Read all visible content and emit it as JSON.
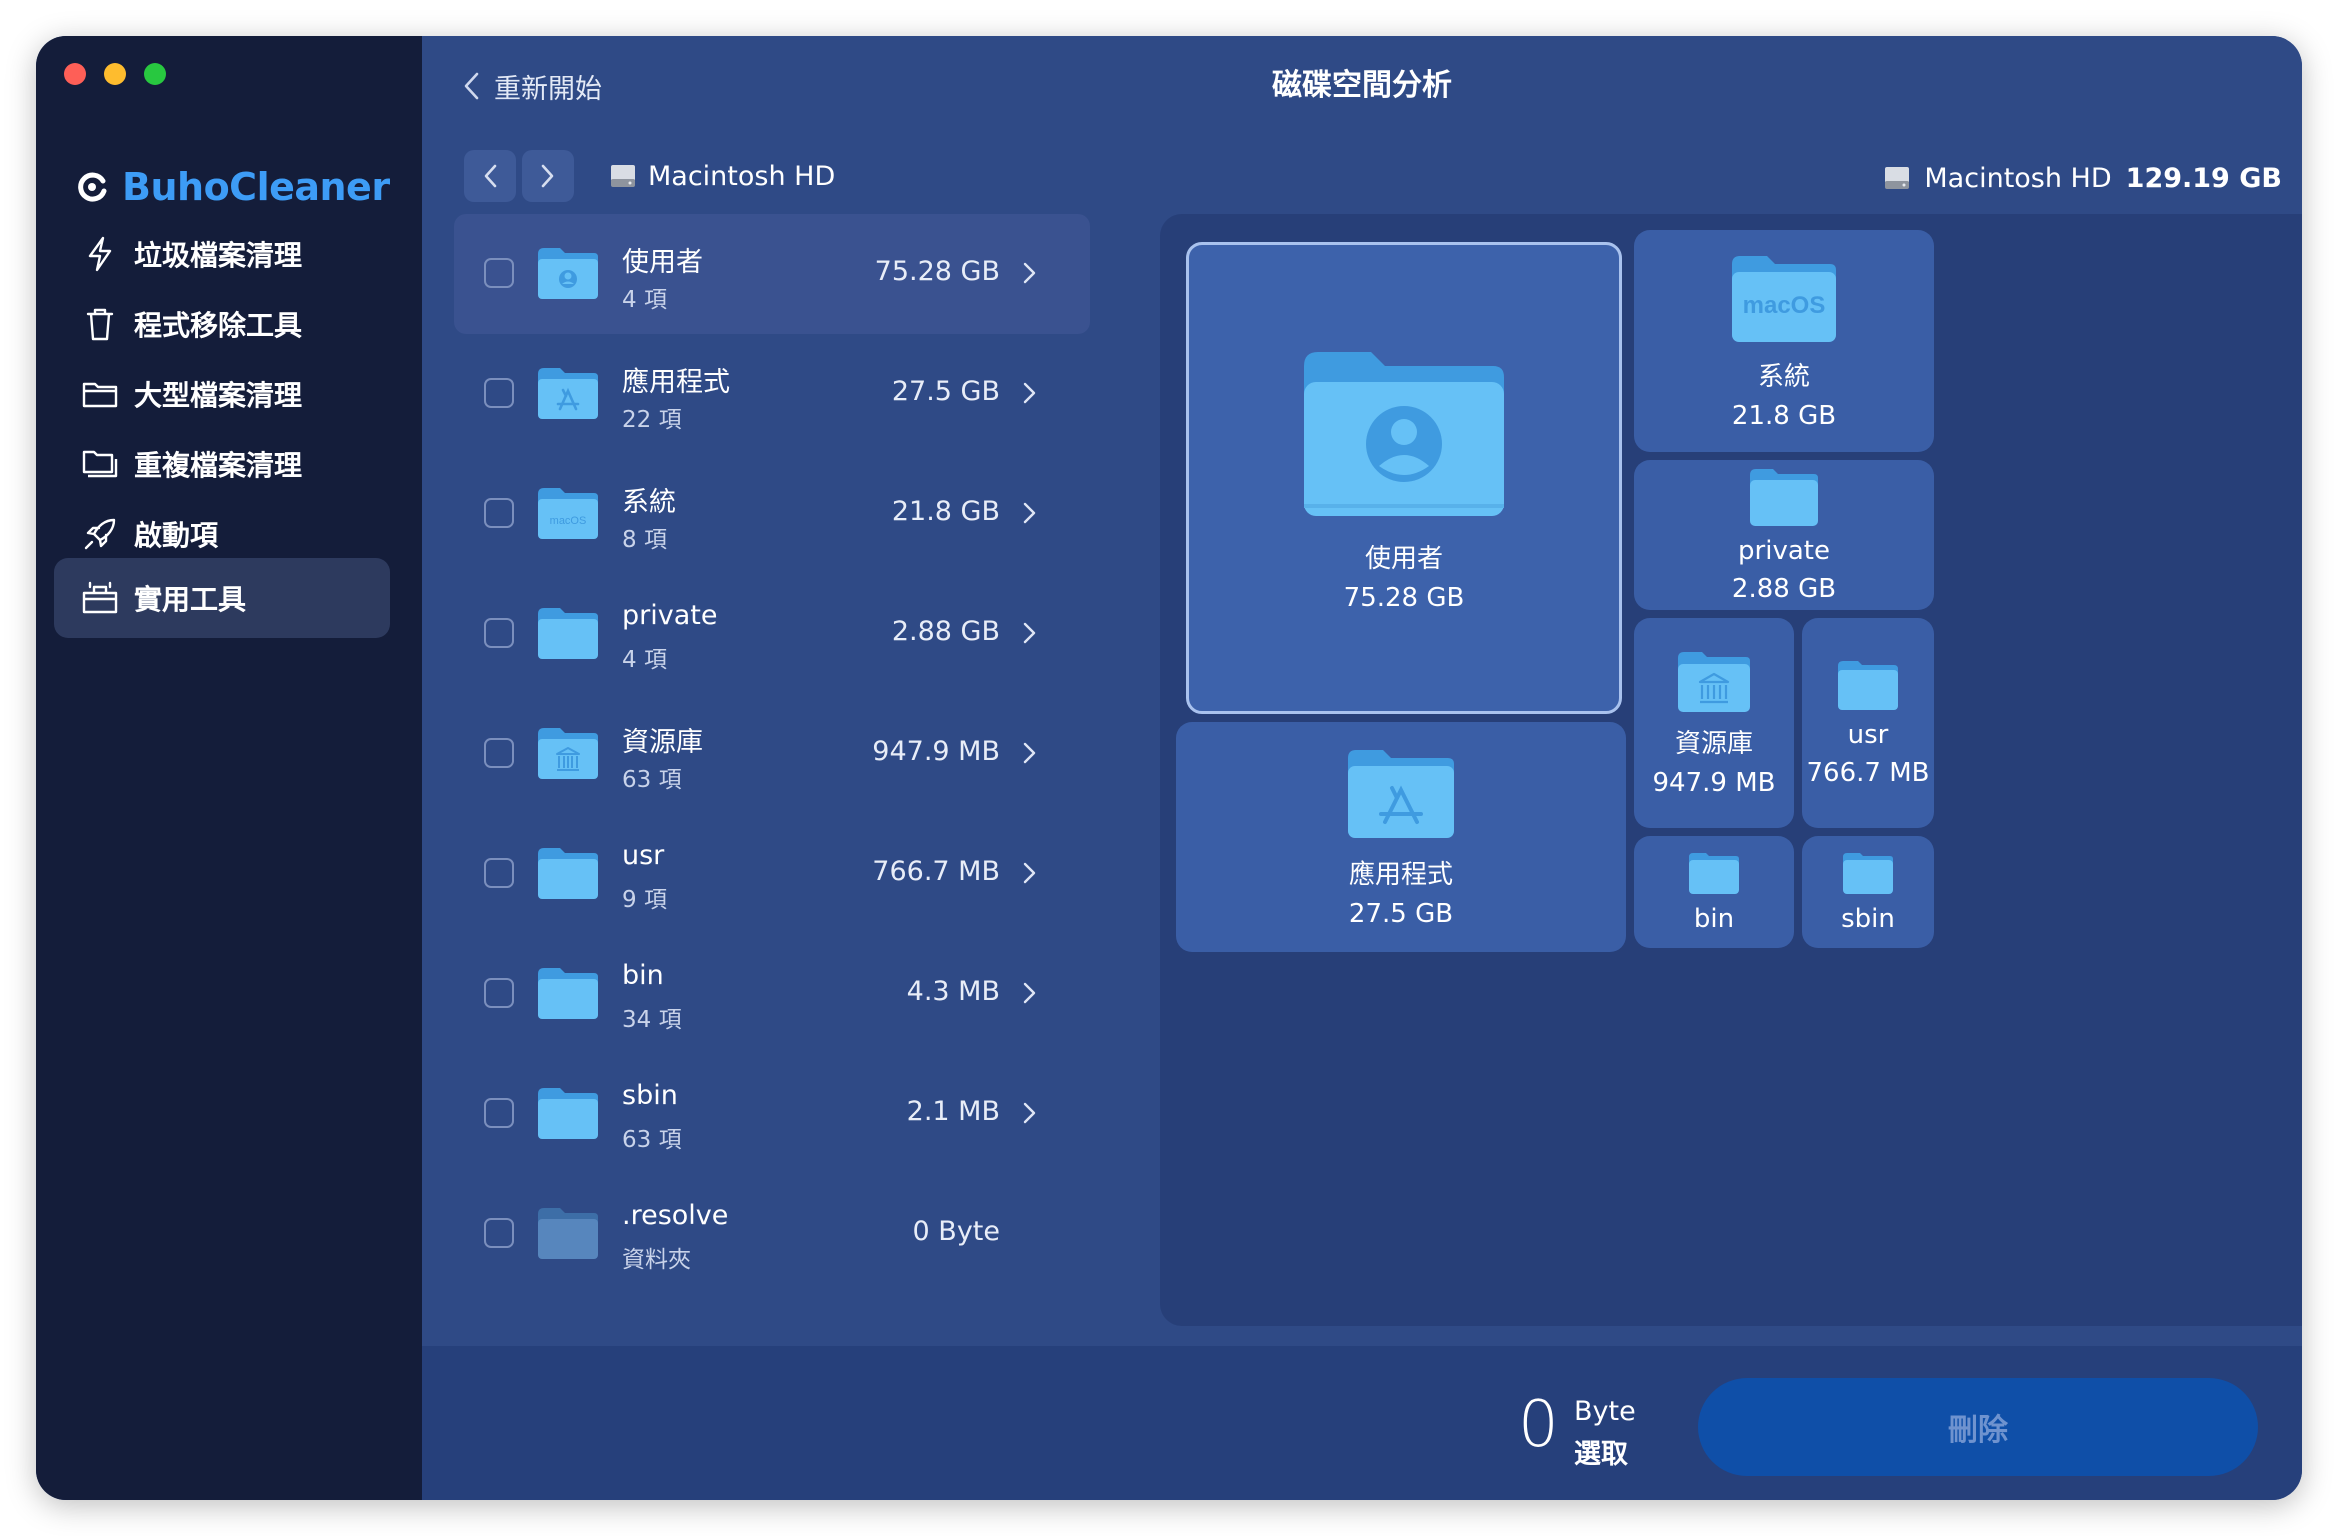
{
  "app": {
    "brand": "BuhoCleaner",
    "window_title": "磁碟空間分析",
    "back_label": "重新開始"
  },
  "sidebar": {
    "items": [
      {
        "label": "垃圾檔案清理",
        "icon": "bolt-icon",
        "active": false
      },
      {
        "label": "程式移除工具",
        "icon": "trash-icon",
        "active": false
      },
      {
        "label": "大型檔案清理",
        "icon": "folder-icon",
        "active": false
      },
      {
        "label": "重複檔案清理",
        "icon": "duplicate-folder-icon",
        "active": false
      },
      {
        "label": "啟動項",
        "icon": "rocket-icon",
        "active": false
      },
      {
        "label": "實用工具",
        "icon": "toolbox-icon",
        "active": true
      }
    ]
  },
  "toolbar": {
    "path": "Macintosh HD",
    "disk_name": "Macintosh HD",
    "disk_size": "129.19 GB"
  },
  "list": {
    "items": [
      {
        "name": "使用者",
        "sub": "4 項",
        "size": "75.28 GB",
        "icon": "user-folder-icon",
        "selected": true
      },
      {
        "name": "應用程式",
        "sub": "22 項",
        "size": "27.5 GB",
        "icon": "apps-folder-icon",
        "selected": false
      },
      {
        "name": "系統",
        "sub": "8 項",
        "size": "21.8 GB",
        "icon": "macos-folder-icon",
        "selected": false
      },
      {
        "name": "private",
        "sub": "4 項",
        "size": "2.88 GB",
        "icon": "folder-icon",
        "selected": false
      },
      {
        "name": "資源庫",
        "sub": "63 項",
        "size": "947.9 MB",
        "icon": "library-folder-icon",
        "selected": false
      },
      {
        "name": "usr",
        "sub": "9 項",
        "size": "766.7 MB",
        "icon": "folder-icon",
        "selected": false
      },
      {
        "name": "bin",
        "sub": "34 項",
        "size": "4.3 MB",
        "icon": "folder-icon",
        "selected": false
      },
      {
        "name": "sbin",
        "sub": "63 項",
        "size": "2.1 MB",
        "icon": "folder-icon",
        "selected": false
      },
      {
        "name": ".resolve",
        "sub": "資料夾",
        "size": "0 Byte",
        "icon": "hidden-folder-icon",
        "selected": false
      }
    ]
  },
  "treemap": {
    "users": {
      "name": "使用者",
      "size": "75.28 GB"
    },
    "apps": {
      "name": "應用程式",
      "size": "27.5 GB"
    },
    "system": {
      "name": "系統",
      "size": "21.8 GB",
      "badge": "macOS"
    },
    "private": {
      "name": "private",
      "size": "2.88 GB"
    },
    "library": {
      "name": "資源庫",
      "size": "947.9 MB"
    },
    "usr": {
      "name": "usr",
      "size": "766.7 MB"
    },
    "bin": {
      "name": "bin"
    },
    "sbin": {
      "name": "sbin"
    }
  },
  "footer": {
    "selected_count": "0",
    "selected_unit": "Byte",
    "selected_label": "選取",
    "delete_label": "刪除"
  },
  "colors": {
    "sidebar_bg": "#141d3a",
    "main_bg": "#2f4a86",
    "brand": "#3d9cf6",
    "folder": "#5fb8f4",
    "delete_button": "#0f4fa8"
  }
}
